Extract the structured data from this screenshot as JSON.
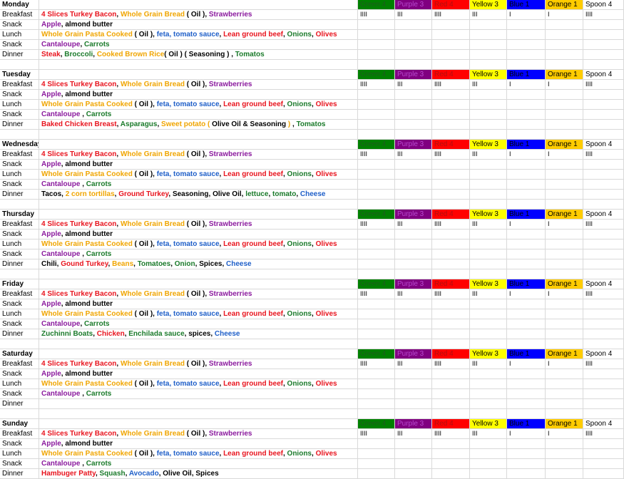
{
  "colors": {
    "red": "#e8141e",
    "orange": "#f0a500",
    "yellow": "#f7c400",
    "purple": "#8b1a9e",
    "green": "#1a7a2a",
    "blue": "#1f5fc8",
    "black": "#000000",
    "green_fill": "#008000",
    "purple_fill": "#800080",
    "red_fill": "#ff0000",
    "yellow_fill": "#ffff00",
    "blue_fill": "#0000ff",
    "orange_fill": "#ffcc00"
  },
  "header_labels": [
    "Green 4",
    "Purple 3",
    "Red 4",
    "Yellow 3",
    "Blue 1",
    "Orange 1",
    "Spoon 4"
  ],
  "header_fills": [
    "green_fill",
    "purple_fill",
    "red_fill",
    "yellow_fill",
    "blue_fill",
    "orange_fill",
    "none"
  ],
  "header_text_colors": [
    "#1f5a1f",
    "#b84bd0",
    "#b01010",
    "#000000",
    "#000000",
    "#000000",
    "#000000"
  ],
  "tallies": [
    "IIII",
    "III",
    "IIII",
    "III",
    "I",
    "I",
    "IIII"
  ],
  "days": [
    {
      "day": "Monday",
      "meals": [
        {
          "meal": "Breakfast",
          "items": [
            [
              "4 Slices Turkey Bacon",
              "red"
            ],
            [
              ", ",
              "black"
            ],
            [
              "Whole Grain Bread",
              "orange"
            ],
            [
              " ( Oil ), ",
              "black"
            ],
            [
              "Strawberries",
              "purple"
            ]
          ]
        },
        {
          "meal": "Snack",
          "items": [
            [
              "Apple",
              "purple"
            ],
            [
              ", almond butter",
              "black"
            ]
          ]
        },
        {
          "meal": "Lunch",
          "items": [
            [
              "Whole Grain Pasta Cooked",
              "orange"
            ],
            [
              " ( Oil ), ",
              "black"
            ],
            [
              "feta, tomato sauce",
              "blue"
            ],
            [
              ", ",
              "black"
            ],
            [
              "Lean ground beef",
              "red"
            ],
            [
              ", ",
              "black"
            ],
            [
              "Onions",
              "green"
            ],
            [
              ", ",
              "black"
            ],
            [
              "Olives",
              "red"
            ]
          ]
        },
        {
          "meal": "Snack",
          "items": [
            [
              "Cantaloupe",
              "purple"
            ],
            [
              ", ",
              "black"
            ],
            [
              "Carrots",
              "green"
            ]
          ]
        },
        {
          "meal": "Dinner",
          "items": [
            [
              "Steak",
              "red"
            ],
            [
              ", ",
              "black"
            ],
            [
              "Broccoli",
              "green"
            ],
            [
              ", ",
              "black"
            ],
            [
              "Cooked Brown Rice",
              "orange"
            ],
            [
              "( Oil ) ( Seasoning ) , ",
              "black"
            ],
            [
              "Tomatos",
              "green"
            ]
          ]
        }
      ]
    },
    {
      "day": "Tuesday",
      "meals": [
        {
          "meal": "Breakfast",
          "items": [
            [
              "4 Slices Turkey Bacon",
              "red"
            ],
            [
              ", ",
              "black"
            ],
            [
              "Whole Grain Bread",
              "orange"
            ],
            [
              " ( Oil ), ",
              "black"
            ],
            [
              "Strawberries",
              "purple"
            ]
          ]
        },
        {
          "meal": "Snack",
          "items": [
            [
              "Apple",
              "purple"
            ],
            [
              ", almond butter",
              "black"
            ]
          ]
        },
        {
          "meal": "Lunch",
          "items": [
            [
              "Whole Grain Pasta Cooked",
              "orange"
            ],
            [
              " ( Oil ), ",
              "black"
            ],
            [
              "feta, tomato sauce",
              "blue"
            ],
            [
              ", ",
              "black"
            ],
            [
              "Lean ground beef",
              "red"
            ],
            [
              ", ",
              "black"
            ],
            [
              "Onions",
              "green"
            ],
            [
              ", ",
              "black"
            ],
            [
              "Olives",
              "red"
            ]
          ]
        },
        {
          "meal": "Snack",
          "items": [
            [
              "Cantaloupe",
              "purple"
            ],
            [
              " , ",
              "black"
            ],
            [
              "Carrots",
              "green"
            ]
          ]
        },
        {
          "meal": "Dinner",
          "items": [
            [
              "Baked Chicken Breast",
              "red"
            ],
            [
              ", ",
              "black"
            ],
            [
              "Asparagus",
              "green"
            ],
            [
              ", ",
              "black"
            ],
            [
              "Sweet potato (",
              "orange"
            ],
            [
              " Olive Oil & Seasoning ",
              "black"
            ],
            [
              ")",
              "orange"
            ],
            [
              " , ",
              "black"
            ],
            [
              "Tomatos",
              "green"
            ]
          ]
        }
      ]
    },
    {
      "day": "Wednesday",
      "meals": [
        {
          "meal": "Breakfast",
          "items": [
            [
              "4 Slices Turkey Bacon",
              "red"
            ],
            [
              ", ",
              "black"
            ],
            [
              "Whole Grain Bread",
              "orange"
            ],
            [
              " ( Oil ), ",
              "black"
            ],
            [
              "Strawberries",
              "purple"
            ]
          ]
        },
        {
          "meal": "Snack",
          "items": [
            [
              "Apple",
              "purple"
            ],
            [
              ", almond butter",
              "black"
            ]
          ]
        },
        {
          "meal": "Lunch",
          "items": [
            [
              "Whole Grain Pasta Cooked",
              "orange"
            ],
            [
              " ( Oil ), ",
              "black"
            ],
            [
              "feta, tomato sauce",
              "blue"
            ],
            [
              ", ",
              "black"
            ],
            [
              "Lean ground beef",
              "red"
            ],
            [
              ", ",
              "black"
            ],
            [
              "Onions",
              "green"
            ],
            [
              ", ",
              "black"
            ],
            [
              "Olives",
              "red"
            ]
          ]
        },
        {
          "meal": "Snack",
          "items": [
            [
              "Cantaloupe",
              "purple"
            ],
            [
              " , ",
              "black"
            ],
            [
              "Carrots",
              "green"
            ]
          ]
        },
        {
          "meal": "Dinner",
          "items": [
            [
              "Tacos, ",
              "black"
            ],
            [
              "2 corn tortillas",
              "orange"
            ],
            [
              ", ",
              "black"
            ],
            [
              "Ground Turkey",
              "red"
            ],
            [
              ", Seasoning, Olive Oil, ",
              "black"
            ],
            [
              "lettuce",
              "green"
            ],
            [
              ", ",
              "black"
            ],
            [
              "tomato",
              "green"
            ],
            [
              ", ",
              "black"
            ],
            [
              "Cheese",
              "blue"
            ]
          ]
        }
      ]
    },
    {
      "day": "Thursday",
      "meals": [
        {
          "meal": "Breakfast",
          "items": [
            [
              "4 Slices Turkey Bacon",
              "red"
            ],
            [
              ", ",
              "black"
            ],
            [
              "Whole Grain Bread",
              "orange"
            ],
            [
              " ( Oil ), ",
              "black"
            ],
            [
              "Strawberries",
              "purple"
            ]
          ]
        },
        {
          "meal": "Snack",
          "items": [
            [
              "Apple",
              "purple"
            ],
            [
              ", almond butter",
              "black"
            ]
          ]
        },
        {
          "meal": "Lunch",
          "items": [
            [
              "Whole Grain Pasta Cooked",
              "orange"
            ],
            [
              " ( Oil ), ",
              "black"
            ],
            [
              "feta, tomato sauce",
              "blue"
            ],
            [
              ", ",
              "black"
            ],
            [
              "Lean ground beef",
              "red"
            ],
            [
              ", ",
              "black"
            ],
            [
              "Onions",
              "green"
            ],
            [
              ", ",
              "black"
            ],
            [
              "Olives",
              "red"
            ]
          ]
        },
        {
          "meal": "Snack",
          "items": [
            [
              "Cantaloupe",
              "purple"
            ],
            [
              " , ",
              "black"
            ],
            [
              "Carrots",
              "green"
            ]
          ]
        },
        {
          "meal": "Dinner",
          "items": [
            [
              "Chili, ",
              "black"
            ],
            [
              "Gound Turkey",
              "red"
            ],
            [
              ", ",
              "black"
            ],
            [
              "Beans",
              "orange"
            ],
            [
              ", ",
              "black"
            ],
            [
              "Tomatoes",
              "green"
            ],
            [
              ", ",
              "black"
            ],
            [
              "Onion",
              "green"
            ],
            [
              ", Spices, ",
              "black"
            ],
            [
              "Cheese",
              "blue"
            ]
          ]
        }
      ]
    },
    {
      "day": "Friday",
      "meals": [
        {
          "meal": "Breakfast",
          "items": [
            [
              "4 Slices Turkey Bacon",
              "red"
            ],
            [
              ", ",
              "black"
            ],
            [
              "Whole Grain Bread",
              "orange"
            ],
            [
              " ( Oil ), ",
              "black"
            ],
            [
              "Strawberries",
              "purple"
            ]
          ]
        },
        {
          "meal": "Snack",
          "items": [
            [
              "Apple",
              "purple"
            ],
            [
              ", almond butter",
              "black"
            ]
          ]
        },
        {
          "meal": "Lunch",
          "items": [
            [
              "Whole Grain Pasta Cooked",
              "orange"
            ],
            [
              " ( Oil ), ",
              "black"
            ],
            [
              "feta, tomato sauce",
              "blue"
            ],
            [
              ", ",
              "black"
            ],
            [
              "Lean ground beef",
              "red"
            ],
            [
              ", ",
              "black"
            ],
            [
              "Onions",
              "green"
            ],
            [
              ", ",
              "black"
            ],
            [
              "Olives",
              "red"
            ]
          ]
        },
        {
          "meal": "Snack",
          "items": [
            [
              "Cantaloupe",
              "purple"
            ],
            [
              ", ",
              "black"
            ],
            [
              "Carrots",
              "green"
            ]
          ]
        },
        {
          "meal": "Dinner",
          "items": [
            [
              "Zuchinni Boats",
              "green"
            ],
            [
              ", ",
              "black"
            ],
            [
              "Chicken",
              "red"
            ],
            [
              ", ",
              "black"
            ],
            [
              "Enchilada sauce",
              "green"
            ],
            [
              ", spices, ",
              "black"
            ],
            [
              "Cheese",
              "blue"
            ]
          ]
        }
      ]
    },
    {
      "day": "Saturday",
      "meals": [
        {
          "meal": "Breakfast",
          "items": [
            [
              "4 Slices Turkey Bacon",
              "red"
            ],
            [
              ", ",
              "black"
            ],
            [
              "Whole Grain Bread",
              "orange"
            ],
            [
              " ( Oil ), ",
              "black"
            ],
            [
              "Strawberries",
              "purple"
            ]
          ]
        },
        {
          "meal": "Snack",
          "items": [
            [
              "Apple",
              "purple"
            ],
            [
              ", almond butter",
              "black"
            ]
          ]
        },
        {
          "meal": "Lunch",
          "items": [
            [
              "Whole Grain Pasta Cooked",
              "orange"
            ],
            [
              " ( Oil ), ",
              "black"
            ],
            [
              "feta, tomato sauce",
              "blue"
            ],
            [
              ", ",
              "black"
            ],
            [
              "Lean ground beef",
              "red"
            ],
            [
              ", ",
              "black"
            ],
            [
              "Onions",
              "green"
            ],
            [
              ", ",
              "black"
            ],
            [
              "Olives",
              "red"
            ]
          ]
        },
        {
          "meal": "Snack",
          "items": [
            [
              "Cantaloupe",
              "purple"
            ],
            [
              " , ",
              "black"
            ],
            [
              "Carrots",
              "green"
            ]
          ]
        },
        {
          "meal": "Dinner",
          "items": []
        }
      ]
    },
    {
      "day": "Sunday",
      "meals": [
        {
          "meal": "Breakfast",
          "items": [
            [
              "4 Slices Turkey Bacon",
              "red"
            ],
            [
              ", ",
              "black"
            ],
            [
              "Whole Grain Bread",
              "orange"
            ],
            [
              " ( Oil ), ",
              "black"
            ],
            [
              "Strawberries",
              "purple"
            ]
          ]
        },
        {
          "meal": "Snack",
          "items": [
            [
              "Apple",
              "purple"
            ],
            [
              ", almond butter",
              "black"
            ]
          ]
        },
        {
          "meal": "Lunch",
          "items": [
            [
              "Whole Grain Pasta Cooked",
              "orange"
            ],
            [
              " ( Oil ), ",
              "black"
            ],
            [
              "feta, tomato sauce",
              "blue"
            ],
            [
              ", ",
              "black"
            ],
            [
              "Lean ground beef",
              "red"
            ],
            [
              ", ",
              "black"
            ],
            [
              "Onions",
              "green"
            ],
            [
              ", ",
              "black"
            ],
            [
              "Olives",
              "red"
            ]
          ]
        },
        {
          "meal": "Snack",
          "items": [
            [
              "Cantaloupe",
              "purple"
            ],
            [
              " , ",
              "black"
            ],
            [
              "Carrots",
              "green"
            ]
          ]
        },
        {
          "meal": "Dinner",
          "items": [
            [
              "Hambuger Patty",
              "red"
            ],
            [
              ", ",
              "black"
            ],
            [
              "Squash",
              "green"
            ],
            [
              ", ",
              "black"
            ],
            [
              "Avocado",
              "blue"
            ],
            [
              ", Olive Oil, Spices",
              "black"
            ]
          ]
        }
      ]
    }
  ]
}
